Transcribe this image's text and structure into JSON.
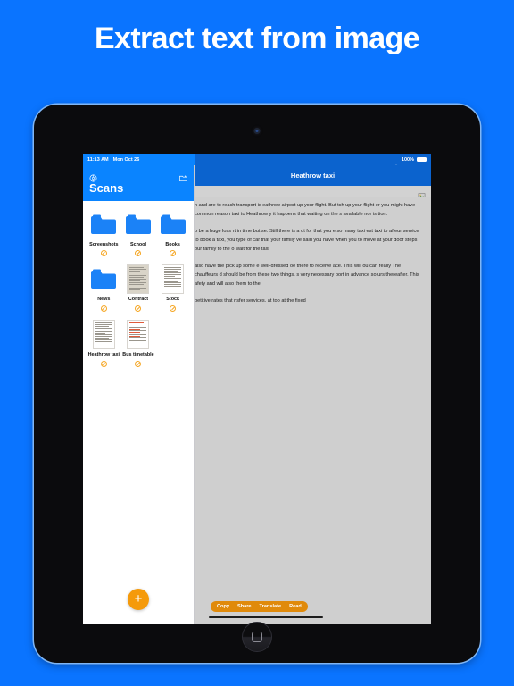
{
  "headline": "Extract text from image",
  "colors": {
    "background_blue": "#0A74FF",
    "ios_blue": "#0A84FF",
    "navbar_blue": "#0B63CE",
    "accent_orange": "#F59A0B",
    "action_bar_orange": "#E08A0B"
  },
  "status_bar": {
    "time": "11:13 AM",
    "date": "Mon Oct 26",
    "wifi_icon": "wifi-icon",
    "battery_percent": "100%",
    "battery_icon": "battery-icon"
  },
  "sidebar": {
    "title": "Scans",
    "settings_icon": "gear-icon",
    "new_folder_icon": "new-folder-icon",
    "add_button_icon": "plus-icon",
    "items": [
      {
        "label": "Screenshots",
        "type": "folder",
        "badge": "no-ocr-badge"
      },
      {
        "label": "School",
        "type": "folder",
        "badge": "no-ocr-badge"
      },
      {
        "label": "Books",
        "type": "folder",
        "badge": "no-ocr-badge"
      },
      {
        "label": "News",
        "type": "folder",
        "badge": "no-ocr-badge"
      },
      {
        "label": "Contract",
        "type": "document",
        "badge": "no-ocr-badge"
      },
      {
        "label": "Stock",
        "type": "document",
        "badge": "no-ocr-badge"
      },
      {
        "label": "Heathrow taxi",
        "type": "document",
        "badge": "no-ocr-badge"
      },
      {
        "label": "Bus timetable",
        "type": "document",
        "badge": "no-ocr-badge"
      }
    ]
  },
  "detail": {
    "nav_title": "Heathrow taxi",
    "image_icon": "image-icon",
    "paragraphs": [
      "n and are to reach transport is eathrow airport up your flight. But tch up your flight er you might have common reason taxi to Heathrow y it happens that waiting on the s available nor is tion.",
      "o be a huge loss rt in time but se. Still there is a ut for that you e so many taxi est taxi to affeur service to book a taxi, you type of car that your family ve said you have when you to move at your door steps our family to the o wait for the taxi",
      "also have the pick up some e well-dressed oe there to receive ace. This will ou can really The chauffeurs d should be from these two things. s very necessary port in advance so urs thereafter. This afety and will also them to the",
      "petitive rates that nsfer services. at too at the fixed"
    ],
    "actions": [
      {
        "label": "Copy"
      },
      {
        "label": "Share"
      },
      {
        "label": "Translate"
      },
      {
        "label": "Read"
      }
    ]
  }
}
